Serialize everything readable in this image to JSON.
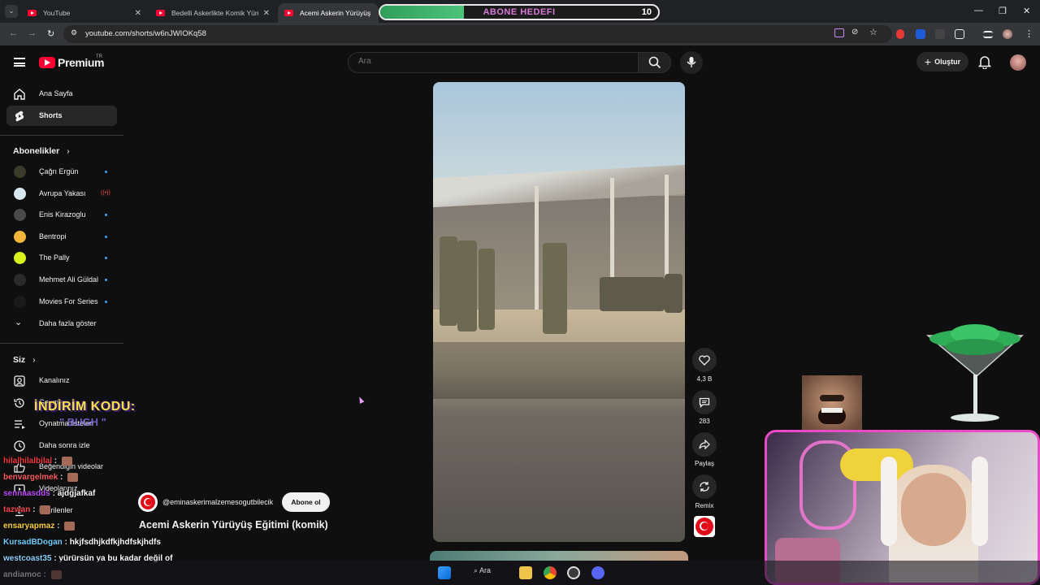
{
  "browser": {
    "tabs": [
      {
        "title": "YouTube",
        "active": false
      },
      {
        "title": "Bedelli Askerlikte Komik Yürüyü",
        "active": false
      },
      {
        "title": "Acemi Askerin Yürüyüş Eğiti",
        "active": true
      }
    ],
    "url": "youtube.com/shorts/w6nJWIOKq58"
  },
  "goal_widget": {
    "title": "ABONE HEDEFI",
    "count": "10",
    "progress": 0.3
  },
  "youtube": {
    "logo_text": "Premium",
    "logo_region": "TR",
    "search_placeholder": "Ara",
    "create_label": "Oluştur",
    "nav": [
      {
        "label": "Ana Sayfa",
        "icon": "home-icon"
      },
      {
        "label": "Shorts",
        "icon": "shorts-icon"
      }
    ],
    "subscriptions_header": "Abonelikler",
    "subscriptions": [
      {
        "label": "Çağrı Ergün",
        "color": "#3b3b2c"
      },
      {
        "label": "Avrupa Yakası",
        "color": "#d7e6ef"
      },
      {
        "label": "Enis Kirazoglu",
        "color": "#4a4a4a"
      },
      {
        "label": "Bentropi",
        "color": "#f2b63a"
      },
      {
        "label": "The Pally",
        "color": "#d8f21c"
      },
      {
        "label": "Mehmet Ali Güldal",
        "color": "#2a2a2a"
      },
      {
        "label": "Movies For Series",
        "color": "#1a1a1a"
      }
    ],
    "show_more_label": "Daha fazla göster",
    "you_header": "Siz",
    "you_items": [
      {
        "label": "Kanalınız",
        "icon": "channel-icon"
      },
      {
        "label": "Geçmiş",
        "icon": "history-icon"
      },
      {
        "label": "Oynatma listeleri",
        "icon": "playlist-icon"
      },
      {
        "label": "Daha sonra izle",
        "icon": "watch-later-icon"
      },
      {
        "label": "Beğendiğin videolar",
        "icon": "like-icon"
      },
      {
        "label": "Videolarınız",
        "icon": "your-videos-icon"
      },
      {
        "label": "İndirilenler",
        "icon": "download-icon"
      }
    ],
    "short": {
      "channel": "@eminaskerimalzemesogutbilecik",
      "subscribe_label": "Abone ol",
      "title": "Acemi Askerin Yürüyüş Eğitimi  (komik)",
      "likes": "4,3 B",
      "comments": "283",
      "share_label": "Paylaş",
      "remix_label": "Remix"
    }
  },
  "stream_overlay": {
    "promo": "İNDİRİM KODU:",
    "promo_code": "\" BUGH \"",
    "chat": [
      {
        "user": "hilalhilalbilal",
        "msg": "",
        "color": "#ff3b3b"
      },
      {
        "user": "benvargelmek",
        "msg": "",
        "color": "#ff5f5f"
      },
      {
        "user": "sennaasdds",
        "msg": "ajdgjafkaf",
        "color": "#c04cff"
      },
      {
        "user": "tazwan",
        "msg": "",
        "color": "#ff4a4a"
      },
      {
        "user": "ensaryapmaz",
        "msg": "",
        "color": "#ffd23c"
      },
      {
        "user": "KursadBDogan",
        "msg": "hkjfsdhjkdfkjhdfskjhdfs",
        "color": "#6fd0ff"
      },
      {
        "user": "westcoast35",
        "msg": "yürürsün ya bu kadar değil of",
        "color": "#8fd3ff"
      },
      {
        "user": "andiamoc",
        "msg": "",
        "color": "#ffffff"
      }
    ]
  },
  "taskbar": {
    "search_label": "Ara"
  }
}
